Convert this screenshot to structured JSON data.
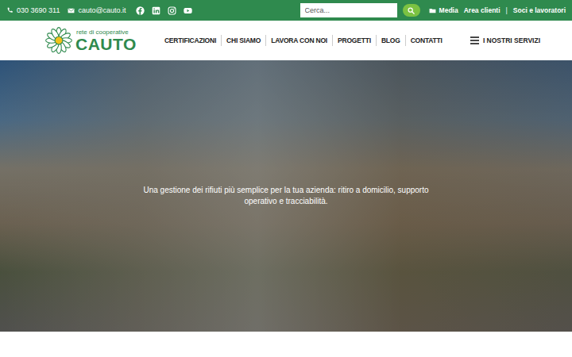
{
  "topbar": {
    "phone": "030 3690 311",
    "email": "cauto@cauto.it",
    "search": {
      "placeholder": "Cerca..."
    },
    "utility_links": [
      {
        "label": "Media",
        "kind": "folder"
      },
      {
        "label": "Area clienti",
        "kind": "plain"
      },
      {
        "label": "|",
        "kind": "separator"
      },
      {
        "label": "Soci e lavoratori",
        "kind": "plain"
      }
    ]
  },
  "logo": {
    "tagline": "rete di cooperative",
    "name": "CAUTO"
  },
  "nav": {
    "items": [
      {
        "label": "CERTIFICAZIONI",
        "selected": false
      },
      {
        "label": "CHI SIAMO",
        "selected": false
      },
      {
        "label": "LAVORA CON NOI",
        "selected": false
      },
      {
        "label": "PROGETTI",
        "selected": false
      },
      {
        "label": "BLOG",
        "selected": false
      },
      {
        "label": "CONTATTI",
        "selected": false
      }
    ],
    "menu_button": "I NOSTRI SERVIZI"
  },
  "hero": {
    "text": "Una gestione dei rifiuti più semplice per la tua azienda: ritiro a domicilio, supporto operativo e tracciabilità."
  }
}
